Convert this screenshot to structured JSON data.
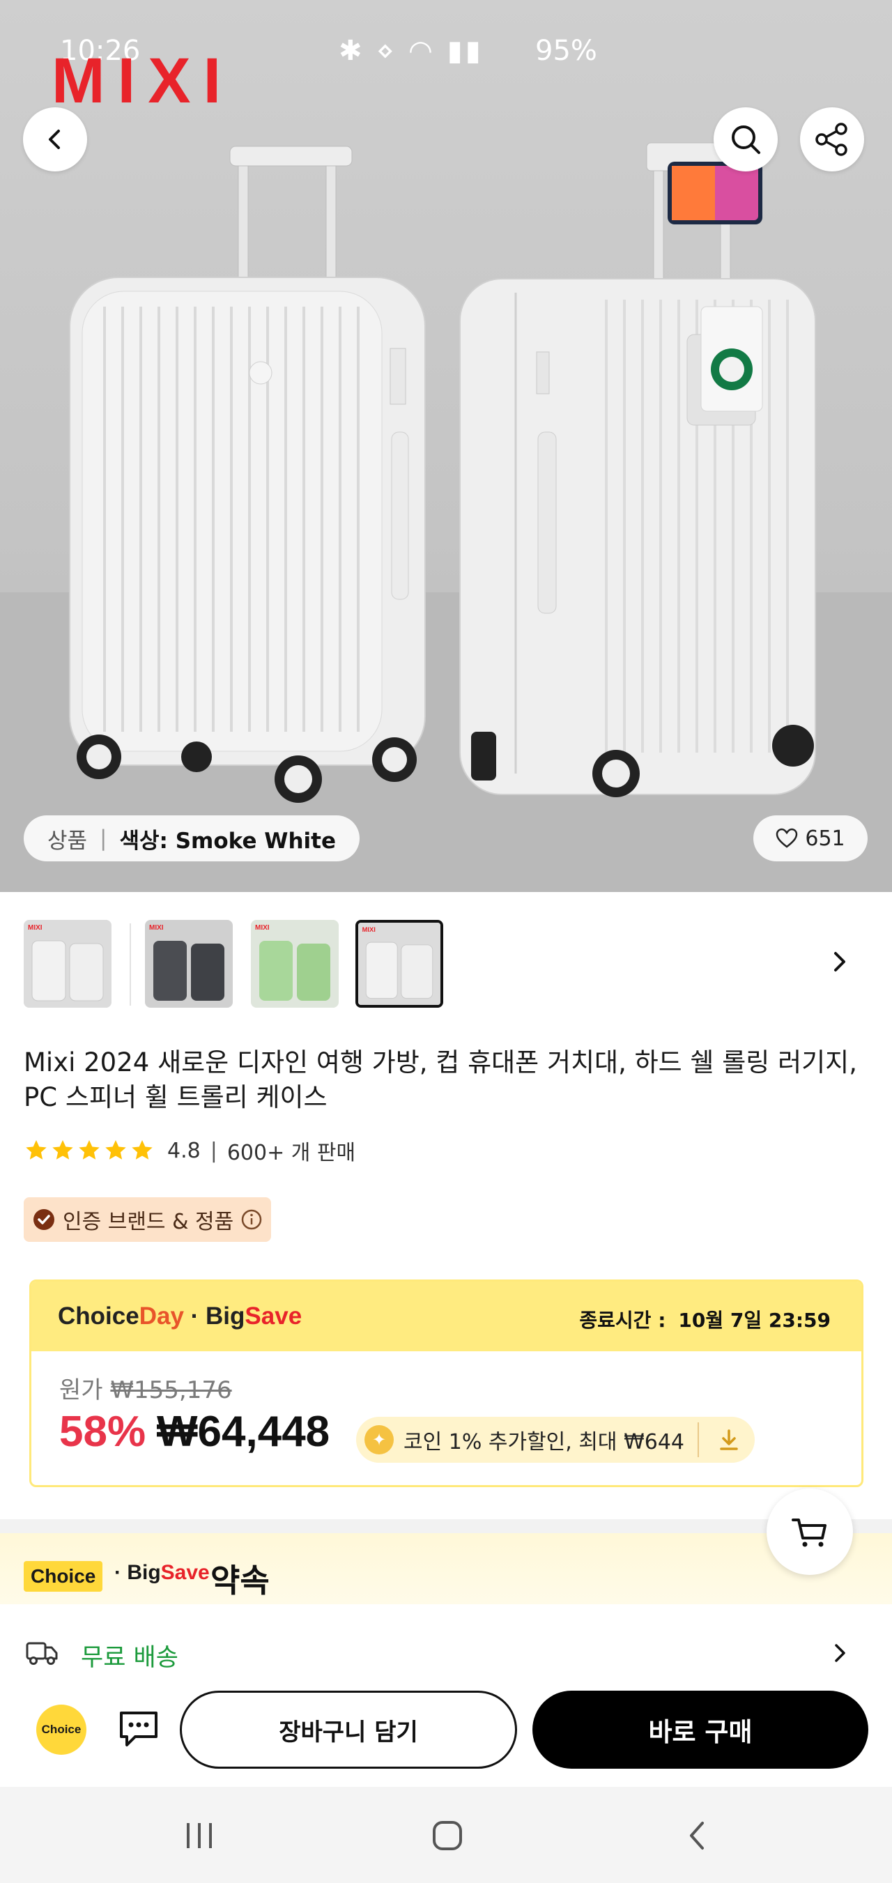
{
  "status_bar": {
    "time": "10:26",
    "battery": "95%"
  },
  "brand": {
    "logo_text": "MIXI"
  },
  "hero": {
    "variant_label": "상품",
    "variant_value": "색상: Smoke White",
    "likes": "651"
  },
  "thumbnails": [
    {
      "name": "white-pair",
      "tag": "MIXI"
    },
    {
      "name": "gray-pair",
      "tag": "MIXI"
    },
    {
      "name": "green-pair",
      "tag": "MIXI"
    },
    {
      "name": "white-pair-selected",
      "tag": "MIXI"
    }
  ],
  "product": {
    "title": "Mixi 2024 새로운 디자인 여행 가방, 컵 휴대폰 거치대, 하드 쉘 롤링 러기지, PC 스피너 휠 트롤리 케이스",
    "rating": "4.8",
    "sold": "600+ 개 판매",
    "stars": 4.8,
    "cert_label": "인증 브랜드 & 정품"
  },
  "price_card": {
    "logo_choice": "Choice",
    "logo_day": "Day",
    "logo_dot": " · ",
    "logo_big": "Big",
    "logo_save": "Save",
    "end_label": "종료시간 :",
    "end_time": "10월 7일 23:59",
    "orig_label": "원가",
    "orig_price": "₩155,176",
    "discount": "58%",
    "price": "₩64,448",
    "coin_text": "코인 1% 추가할인, 최대 ₩644"
  },
  "choice_section": {
    "badge": "Choice",
    "dot": " · ",
    "big": "Big",
    "save": "Save",
    "promise": "약속",
    "shipping": "무료 배송"
  },
  "bottom_bar": {
    "choice_icon_text": "Choice",
    "cart_label": "장바구니 담기",
    "buy_label": "바로 구매"
  },
  "colors": {
    "accent_red": "#e8344a",
    "choice_yellow": "#ffd83a",
    "shipping_green": "#1b9a3b"
  }
}
